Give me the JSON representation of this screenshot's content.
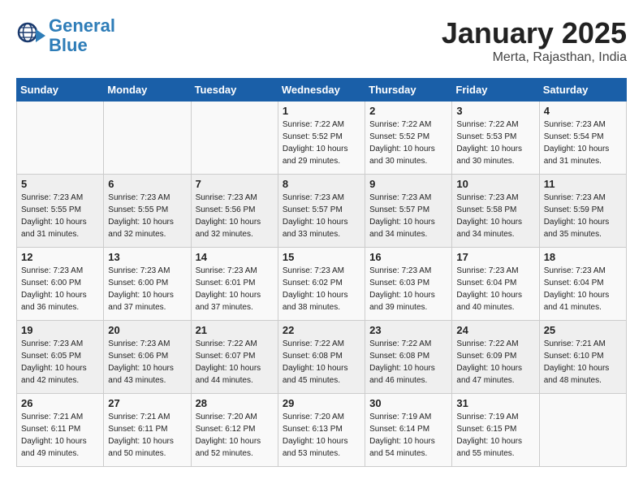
{
  "header": {
    "logo_line1": "General",
    "logo_line2": "Blue",
    "month": "January 2025",
    "location": "Merta, Rajasthan, India"
  },
  "days_of_week": [
    "Sunday",
    "Monday",
    "Tuesday",
    "Wednesday",
    "Thursday",
    "Friday",
    "Saturday"
  ],
  "weeks": [
    [
      {
        "day": "",
        "info": ""
      },
      {
        "day": "",
        "info": ""
      },
      {
        "day": "",
        "info": ""
      },
      {
        "day": "1",
        "info": "Sunrise: 7:22 AM\nSunset: 5:52 PM\nDaylight: 10 hours and 29 minutes."
      },
      {
        "day": "2",
        "info": "Sunrise: 7:22 AM\nSunset: 5:52 PM\nDaylight: 10 hours and 30 minutes."
      },
      {
        "day": "3",
        "info": "Sunrise: 7:22 AM\nSunset: 5:53 PM\nDaylight: 10 hours and 30 minutes."
      },
      {
        "day": "4",
        "info": "Sunrise: 7:23 AM\nSunset: 5:54 PM\nDaylight: 10 hours and 31 minutes."
      }
    ],
    [
      {
        "day": "5",
        "info": "Sunrise: 7:23 AM\nSunset: 5:55 PM\nDaylight: 10 hours and 31 minutes."
      },
      {
        "day": "6",
        "info": "Sunrise: 7:23 AM\nSunset: 5:55 PM\nDaylight: 10 hours and 32 minutes."
      },
      {
        "day": "7",
        "info": "Sunrise: 7:23 AM\nSunset: 5:56 PM\nDaylight: 10 hours and 32 minutes."
      },
      {
        "day": "8",
        "info": "Sunrise: 7:23 AM\nSunset: 5:57 PM\nDaylight: 10 hours and 33 minutes."
      },
      {
        "day": "9",
        "info": "Sunrise: 7:23 AM\nSunset: 5:57 PM\nDaylight: 10 hours and 34 minutes."
      },
      {
        "day": "10",
        "info": "Sunrise: 7:23 AM\nSunset: 5:58 PM\nDaylight: 10 hours and 34 minutes."
      },
      {
        "day": "11",
        "info": "Sunrise: 7:23 AM\nSunset: 5:59 PM\nDaylight: 10 hours and 35 minutes."
      }
    ],
    [
      {
        "day": "12",
        "info": "Sunrise: 7:23 AM\nSunset: 6:00 PM\nDaylight: 10 hours and 36 minutes."
      },
      {
        "day": "13",
        "info": "Sunrise: 7:23 AM\nSunset: 6:00 PM\nDaylight: 10 hours and 37 minutes."
      },
      {
        "day": "14",
        "info": "Sunrise: 7:23 AM\nSunset: 6:01 PM\nDaylight: 10 hours and 37 minutes."
      },
      {
        "day": "15",
        "info": "Sunrise: 7:23 AM\nSunset: 6:02 PM\nDaylight: 10 hours and 38 minutes."
      },
      {
        "day": "16",
        "info": "Sunrise: 7:23 AM\nSunset: 6:03 PM\nDaylight: 10 hours and 39 minutes."
      },
      {
        "day": "17",
        "info": "Sunrise: 7:23 AM\nSunset: 6:04 PM\nDaylight: 10 hours and 40 minutes."
      },
      {
        "day": "18",
        "info": "Sunrise: 7:23 AM\nSunset: 6:04 PM\nDaylight: 10 hours and 41 minutes."
      }
    ],
    [
      {
        "day": "19",
        "info": "Sunrise: 7:23 AM\nSunset: 6:05 PM\nDaylight: 10 hours and 42 minutes."
      },
      {
        "day": "20",
        "info": "Sunrise: 7:23 AM\nSunset: 6:06 PM\nDaylight: 10 hours and 43 minutes."
      },
      {
        "day": "21",
        "info": "Sunrise: 7:22 AM\nSunset: 6:07 PM\nDaylight: 10 hours and 44 minutes."
      },
      {
        "day": "22",
        "info": "Sunrise: 7:22 AM\nSunset: 6:08 PM\nDaylight: 10 hours and 45 minutes."
      },
      {
        "day": "23",
        "info": "Sunrise: 7:22 AM\nSunset: 6:08 PM\nDaylight: 10 hours and 46 minutes."
      },
      {
        "day": "24",
        "info": "Sunrise: 7:22 AM\nSunset: 6:09 PM\nDaylight: 10 hours and 47 minutes."
      },
      {
        "day": "25",
        "info": "Sunrise: 7:21 AM\nSunset: 6:10 PM\nDaylight: 10 hours and 48 minutes."
      }
    ],
    [
      {
        "day": "26",
        "info": "Sunrise: 7:21 AM\nSunset: 6:11 PM\nDaylight: 10 hours and 49 minutes."
      },
      {
        "day": "27",
        "info": "Sunrise: 7:21 AM\nSunset: 6:11 PM\nDaylight: 10 hours and 50 minutes."
      },
      {
        "day": "28",
        "info": "Sunrise: 7:20 AM\nSunset: 6:12 PM\nDaylight: 10 hours and 52 minutes."
      },
      {
        "day": "29",
        "info": "Sunrise: 7:20 AM\nSunset: 6:13 PM\nDaylight: 10 hours and 53 minutes."
      },
      {
        "day": "30",
        "info": "Sunrise: 7:19 AM\nSunset: 6:14 PM\nDaylight: 10 hours and 54 minutes."
      },
      {
        "day": "31",
        "info": "Sunrise: 7:19 AM\nSunset: 6:15 PM\nDaylight: 10 hours and 55 minutes."
      },
      {
        "day": "",
        "info": ""
      }
    ]
  ]
}
